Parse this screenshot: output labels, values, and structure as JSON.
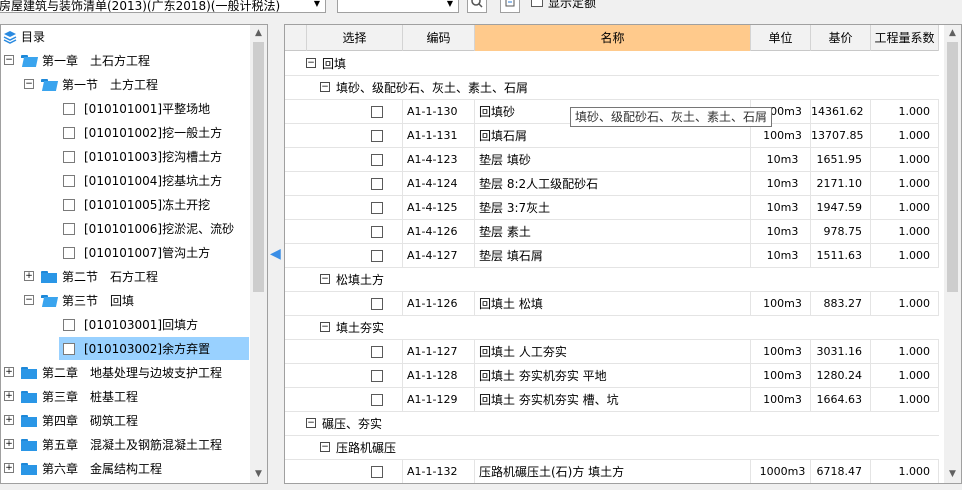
{
  "toolbar": {
    "library_value": "房屋建筑与装饰清单(2013)(广东2018)(一般计税法)",
    "search_value": "",
    "show_deprecated_label": "显示定额"
  },
  "tree": {
    "root_label": "目录",
    "items": [
      {
        "label": "第一章　土石方工程",
        "type": "folder",
        "state": "open"
      },
      {
        "label": "第一节　土方工程",
        "type": "folder",
        "state": "open"
      },
      {
        "label": "[010101001]平整场地",
        "type": "leaf"
      },
      {
        "label": "[010101002]挖一般土方",
        "type": "leaf"
      },
      {
        "label": "[010101003]挖沟槽土方",
        "type": "leaf"
      },
      {
        "label": "[010101004]挖基坑土方",
        "type": "leaf"
      },
      {
        "label": "[010101005]冻土开挖",
        "type": "leaf"
      },
      {
        "label": "[010101006]挖淤泥、流砂",
        "type": "leaf"
      },
      {
        "label": "[010101007]管沟土方",
        "type": "leaf"
      },
      {
        "label": "第二节　石方工程",
        "type": "folder",
        "state": "closed"
      },
      {
        "label": "第三节　回填",
        "type": "folder",
        "state": "open"
      },
      {
        "label": "[010103001]回填方",
        "type": "leaf",
        "selected": true
      },
      {
        "label": "[010103002]余方弃置",
        "type": "leaf"
      },
      {
        "label": "第二章　地基处理与边坡支护工程",
        "type": "folder",
        "state": "closed"
      },
      {
        "label": "第三章　桩基工程",
        "type": "folder",
        "state": "closed"
      },
      {
        "label": "第四章　砌筑工程",
        "type": "folder",
        "state": "closed"
      },
      {
        "label": "第五章　混凝土及钢筋混凝土工程",
        "type": "folder",
        "state": "closed"
      },
      {
        "label": "第六章　金属结构工程",
        "type": "folder",
        "state": "closed"
      }
    ]
  },
  "grid": {
    "columns": [
      "选择",
      "编码",
      "名称",
      "单位",
      "基价",
      "工程量系数"
    ],
    "sorted_column": "名称",
    "rows": [
      {
        "kind": "group",
        "level": 0,
        "label": "回填"
      },
      {
        "kind": "group",
        "level": 1,
        "label": "填砂、级配砂石、灰土、素土、石屑"
      },
      {
        "kind": "item",
        "code": "A1-1-130",
        "name": "回填砂",
        "unit": "100m3",
        "price": "14361.62",
        "factor": "1.000"
      },
      {
        "kind": "item",
        "code": "A1-1-131",
        "name": "回填石屑",
        "unit": "100m3",
        "price": "13707.85",
        "factor": "1.000"
      },
      {
        "kind": "item",
        "code": "A1-4-123",
        "name": "垫层 填砂",
        "unit": "10m3",
        "price": "1651.95",
        "factor": "1.000"
      },
      {
        "kind": "item",
        "code": "A1-4-124",
        "name": "垫层 8:2人工级配砂石",
        "unit": "10m3",
        "price": "2171.10",
        "factor": "1.000"
      },
      {
        "kind": "item",
        "code": "A1-4-125",
        "name": "垫层 3:7灰土",
        "unit": "10m3",
        "price": "1947.59",
        "factor": "1.000"
      },
      {
        "kind": "item",
        "code": "A1-4-126",
        "name": "垫层 素土",
        "unit": "10m3",
        "price": "978.75",
        "factor": "1.000"
      },
      {
        "kind": "item",
        "code": "A1-4-127",
        "name": "垫层 填石屑",
        "unit": "10m3",
        "price": "1511.63",
        "factor": "1.000"
      },
      {
        "kind": "group",
        "level": 1,
        "label": "松填土方"
      },
      {
        "kind": "item",
        "code": "A1-1-126",
        "name": "回填土 松填",
        "unit": "100m3",
        "price": "883.27",
        "factor": "1.000"
      },
      {
        "kind": "group",
        "level": 1,
        "label": "填土夯实"
      },
      {
        "kind": "item",
        "code": "A1-1-127",
        "name": "回填土 人工夯实",
        "unit": "100m3",
        "price": "3031.16",
        "factor": "1.000"
      },
      {
        "kind": "item",
        "code": "A1-1-128",
        "name": "回填土 夯实机夯实 平地",
        "unit": "100m3",
        "price": "1280.24",
        "factor": "1.000"
      },
      {
        "kind": "item",
        "code": "A1-1-129",
        "name": "回填土 夯实机夯实 槽、坑",
        "unit": "100m3",
        "price": "1664.63",
        "factor": "1.000"
      },
      {
        "kind": "group",
        "level": 0,
        "label": "碾压、夯实"
      },
      {
        "kind": "group",
        "level": 1,
        "label": "压路机碾压"
      },
      {
        "kind": "item",
        "code": "A1-1-132",
        "name": "压路机碾压土(石)方 填土方",
        "unit": "1000m3",
        "price": "6718.47",
        "factor": "1.000"
      }
    ]
  },
  "tooltip": "填砂、级配砂石、灰土、素土、石屑"
}
